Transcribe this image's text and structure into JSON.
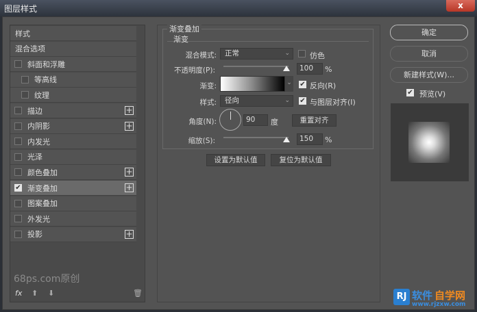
{
  "title": "图层样式",
  "close_label": "x",
  "styles_list": [
    {
      "label": "样式",
      "checkbox": false,
      "plus": false
    },
    {
      "label": "混合选项",
      "checkbox": false,
      "plus": false
    },
    {
      "label": "斜面和浮雕",
      "checkbox": true,
      "checked": false,
      "plus": false
    },
    {
      "label": "等高线",
      "checkbox": true,
      "checked": false,
      "plus": false,
      "indent": true
    },
    {
      "label": "纹理",
      "checkbox": true,
      "checked": false,
      "plus": false,
      "indent": true
    },
    {
      "label": "描边",
      "checkbox": true,
      "checked": false,
      "plus": true
    },
    {
      "label": "内阴影",
      "checkbox": true,
      "checked": false,
      "plus": true
    },
    {
      "label": "内发光",
      "checkbox": true,
      "checked": false,
      "plus": false
    },
    {
      "label": "光泽",
      "checkbox": true,
      "checked": false,
      "plus": false
    },
    {
      "label": "颜色叠加",
      "checkbox": true,
      "checked": false,
      "plus": true
    },
    {
      "label": "渐变叠加",
      "checkbox": true,
      "checked": true,
      "plus": true,
      "selected": true
    },
    {
      "label": "图案叠加",
      "checkbox": true,
      "checked": false,
      "plus": false
    },
    {
      "label": "外发光",
      "checkbox": true,
      "checked": false,
      "plus": false
    },
    {
      "label": "投影",
      "checkbox": true,
      "checked": false,
      "plus": true
    }
  ],
  "watermark": "68ps.com原创",
  "bottom": {
    "fx": "fx"
  },
  "panel": {
    "section_title": "渐变叠加",
    "group_title": "渐变",
    "blend_mode_label": "混合模式:",
    "blend_mode": "正常",
    "dither_label": "仿色",
    "dither": false,
    "opacity_label": "不透明度(P):",
    "opacity": "100",
    "opacity_unit": "%",
    "gradient_label": "渐变:",
    "reverse_label": "反向(R)",
    "reverse": true,
    "style_label": "样式:",
    "style": "径向",
    "align_label": "与图层对齐(I)",
    "align": true,
    "angle_label": "角度(N):",
    "angle": "90",
    "angle_unit": "度",
    "reset_align": "重置对齐",
    "scale_label": "缩放(S):",
    "scale": "150",
    "scale_unit": "%",
    "make_default": "设置为默认值",
    "reset_default": "复位为默认值"
  },
  "right": {
    "ok": "确定",
    "cancel": "取消",
    "new_style": "新建样式(W)...",
    "preview_label": "预览(V)",
    "preview": true
  },
  "logo": {
    "mark": "RJ",
    "text1": "软件",
    "text2": "自学网",
    "url": "www.rjzxw.com"
  }
}
